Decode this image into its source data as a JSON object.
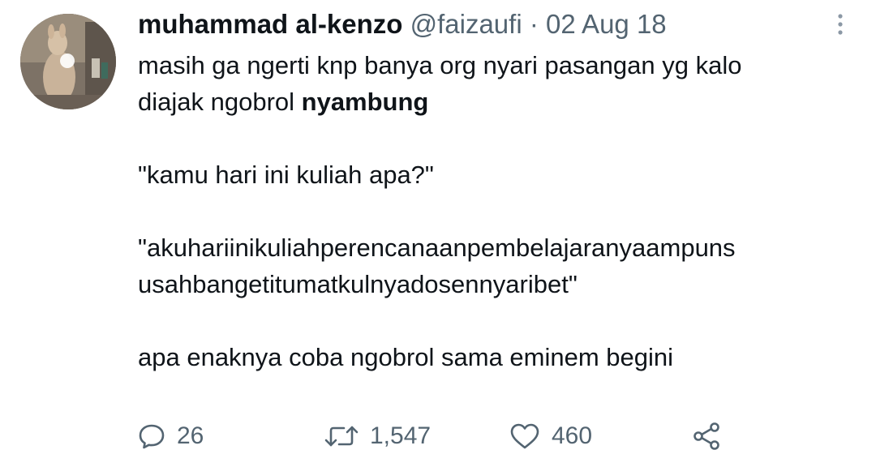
{
  "tweet": {
    "author_name": "muhammad al-kenzo",
    "handle": "@faizaufi",
    "separator": "·",
    "date": "02 Aug 18",
    "avatar_icon": "kangaroo-photo-avatar",
    "more_icon": "more-vertical-icon",
    "text": {
      "line1_part1": "masih ga ngerti knp banya org nyari pasangan yg kalo",
      "line2_part1": "diajak ngobrol ",
      "line2_bold": "nyambung",
      "question": "\"kamu hari ini kuliah apa?\"",
      "answer_line1": "\"akuhariinikuliahperencanaanpembelajaranyaampuns",
      "answer_line2": "usahbangetitumatkulnyadosennyaribet\"",
      "closing": "apa enaknya coba ngobrol sama eminem begini"
    },
    "actions": {
      "replies": "26",
      "retweets": "1,547",
      "likes": "460",
      "reply_icon": "reply-icon",
      "retweet_icon": "retweet-icon",
      "like_icon": "heart-icon",
      "share_icon": "share-icon"
    },
    "colors": {
      "text": "#0f1419",
      "secondary": "#536471"
    }
  }
}
